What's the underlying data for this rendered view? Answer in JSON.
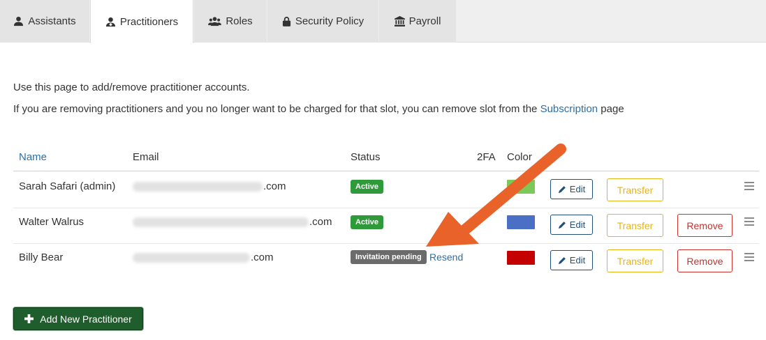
{
  "tabs": [
    {
      "label": "Assistants",
      "icon": "user-icon"
    },
    {
      "label": "Practitioners",
      "icon": "user-doctor-icon",
      "active": true
    },
    {
      "label": "Roles",
      "icon": "users-icon"
    },
    {
      "label": "Security Policy",
      "icon": "lock-icon"
    },
    {
      "label": "Payroll",
      "icon": "bank-icon"
    }
  ],
  "intro": {
    "line1": "Use this page to add/remove practitioner accounts.",
    "line2_prefix": "If you are removing practitioners and you no longer want to be charged for that slot, you can remove slot from the",
    "line2_link": "Subscription",
    "line2_suffix": "page"
  },
  "table": {
    "headers": {
      "name": "Name",
      "email": "Email",
      "status": "Status",
      "twofa": "2FA",
      "color": "Color"
    },
    "rows": [
      {
        "name": "Sarah Safari (admin)",
        "email_suffix": ".com",
        "status": "Active",
        "status_color": "#2f9a3a",
        "color": "#7cc95a",
        "edit": "Edit",
        "transfer": "Transfer"
      },
      {
        "name": "Walter Walrus",
        "email_suffix": ".com",
        "status": "Active",
        "status_color": "#2f9a3a",
        "color": "#4a6fc4",
        "edit": "Edit",
        "transfer": "Transfer",
        "remove": "Remove"
      },
      {
        "name": "Billy Bear",
        "email_suffix": ".com",
        "status": "Invitation pending",
        "status_color": "#6b6b6b",
        "resend": "Resend",
        "color": "#c40000",
        "edit": "Edit",
        "transfer": "Transfer",
        "remove": "Remove"
      }
    ]
  },
  "add_button": {
    "label": "Add New Practitioner",
    "icon": "plus-icon"
  },
  "annotation": {
    "arrow_color": "#e8622a",
    "icon": "arrow-annotation"
  }
}
